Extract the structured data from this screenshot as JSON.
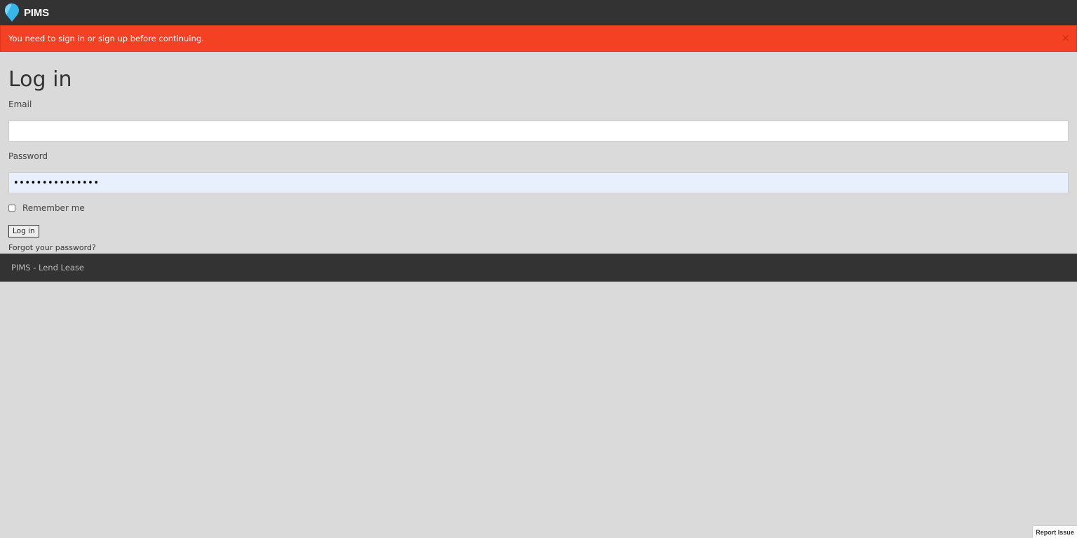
{
  "navbar": {
    "logo_icon": "pin-drop-icon",
    "logo_color": "#38b6e8",
    "brand": "PIMS"
  },
  "alert": {
    "message": "You need to sign in or sign up before continuing.",
    "close_symbol": "×",
    "background_color": "#f44124"
  },
  "form": {
    "title": "Log in",
    "email_label": "Email",
    "email_value": "",
    "password_label": "Password",
    "password_value": "•••••••••••••••",
    "remember_label": "Remember me",
    "remember_checked": false,
    "submit_label": "Log in",
    "forgot_link": "Forgot your password?"
  },
  "footer": {
    "text": "PIMS - Lend Lease"
  },
  "report_issue": {
    "label": "Report Issue"
  }
}
